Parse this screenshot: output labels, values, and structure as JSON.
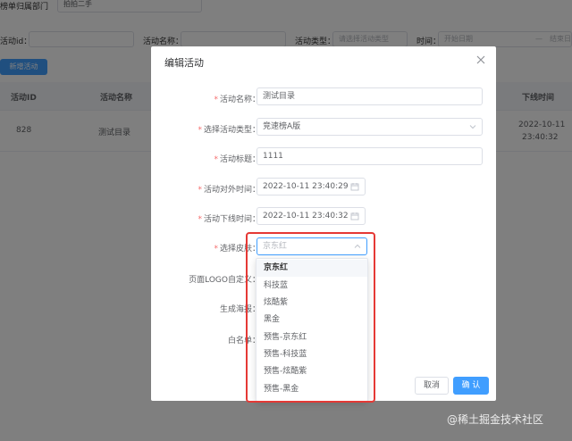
{
  "filters": {
    "dept_label": "榜单归属部门",
    "dept_value": "拍拍二手",
    "id_label": "活动id：",
    "name_label": "活动名称：",
    "type_label": "活动类型：",
    "type_placeholder": "请选择活动类型",
    "time_label": "时间：",
    "start_placeholder": "开始日期",
    "range_sep": "—",
    "end_placeholder": "结束日"
  },
  "toolbar": {
    "add_label": "新增活动"
  },
  "table": {
    "headers": {
      "id": "活动ID",
      "name": "活动名称",
      "offline": "下线时间"
    },
    "row": {
      "id": "828",
      "name": "测试目录",
      "offline_date": "2022-10-11",
      "offline_time": "23:40:32"
    }
  },
  "dialog": {
    "title": "编辑活动",
    "fields": {
      "name_label": "活动名称：",
      "name_value": "测试目录",
      "type_label": "选择活动类型：",
      "type_value": "竞速榜A版",
      "title_label": "活动标题：",
      "title_value": "1111",
      "online_label": "活动对外时间：",
      "online_value": "2022-10-11 23:40:29",
      "offline_label": "活动下线时间：",
      "offline_value": "2022-10-11 23:40:32",
      "skin_label": "选择皮肤：",
      "skin_placeholder": "京东红",
      "logo_label": "页面LOGO自定义：",
      "poster_label": "生成海报：",
      "whitelist_label": "白名单："
    },
    "cancel_label": "取消",
    "ok_label": "确 认"
  },
  "skin_options": [
    "京东红",
    "科技蓝",
    "炫酷紫",
    "黑金",
    "预售-京东红",
    "预售-科技蓝",
    "预售-炫酷紫",
    "预售-黑金"
  ],
  "selected_skin_index": 0,
  "watermark": "@稀土掘金技术社区",
  "colors": {
    "primary": "#409eff",
    "required": "#f56c6c",
    "highlight": "#e53935"
  }
}
